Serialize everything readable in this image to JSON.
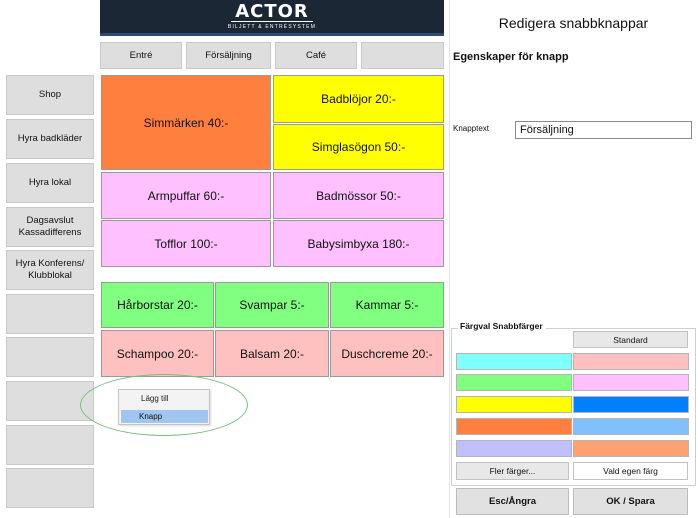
{
  "logo": {
    "main": "ACTOR",
    "sub": "BILJETT & ENTRÉSYSTEM"
  },
  "tabs": [
    "Entré",
    "Försäljning",
    "Café",
    ""
  ],
  "sidebar": {
    "items": [
      "Shop",
      "Hyra badkläder",
      "Hyra lokal",
      "Dagsavslut\nKassadifferens",
      "Hyra Konferens/\nKlubblokal",
      "",
      "",
      "",
      "",
      ""
    ]
  },
  "tiles": [
    {
      "label": "Simmärken 40:-",
      "color": "#ff7f3f"
    },
    {
      "label": "Badblöjor 20:-",
      "color": "#ffff00"
    },
    {
      "label": "Simglasögon 50:-",
      "color": "#ffff00"
    },
    {
      "label": "Armpuffar 60:-",
      "color": "#ffc0ff"
    },
    {
      "label": "Badmössor 50:-",
      "color": "#ffc0ff"
    },
    {
      "label": "Tofflor 100:-",
      "color": "#ffc0ff"
    },
    {
      "label": "Babysimbyxa 180:-",
      "color": "#ffc0ff"
    },
    {
      "label": "Hårborstar 20:-",
      "color": "#80ff80"
    },
    {
      "label": "Svampar 5:-",
      "color": "#80ff80"
    },
    {
      "label": "Kammar 5:-",
      "color": "#80ff80"
    },
    {
      "label": "Schampoo 20:-",
      "color": "#ffc0c0"
    },
    {
      "label": "Balsam 20:-",
      "color": "#ffc0c0"
    },
    {
      "label": "Duschcreme 20:-",
      "color": "#ffc0c0"
    }
  ],
  "context_menu": {
    "title": "Lägg till",
    "item": "Knapp"
  },
  "panel": {
    "title": "Redigera snabbknappar",
    "props_heading": "Egenskaper för knapp",
    "field_label": "Knapptext",
    "field_value": "Försäljning",
    "color_group_label": "Färgval Snabbfärger",
    "standard_button": "Standard",
    "swatches_left": [
      "#80ffff",
      "#80ff80",
      "#ffff00",
      "#ff7f3f",
      "#c0c0ff"
    ],
    "swatches_right": [
      "#ffc0c0",
      "#ffc0ff",
      "#0080ff",
      "#80c0ff",
      "#ffa070"
    ],
    "more_colors_button": "Fler färger...",
    "custom_color_button": "Vald egen färg",
    "cancel_button": "Esc/Ångra",
    "ok_button": "OK / Spara"
  }
}
